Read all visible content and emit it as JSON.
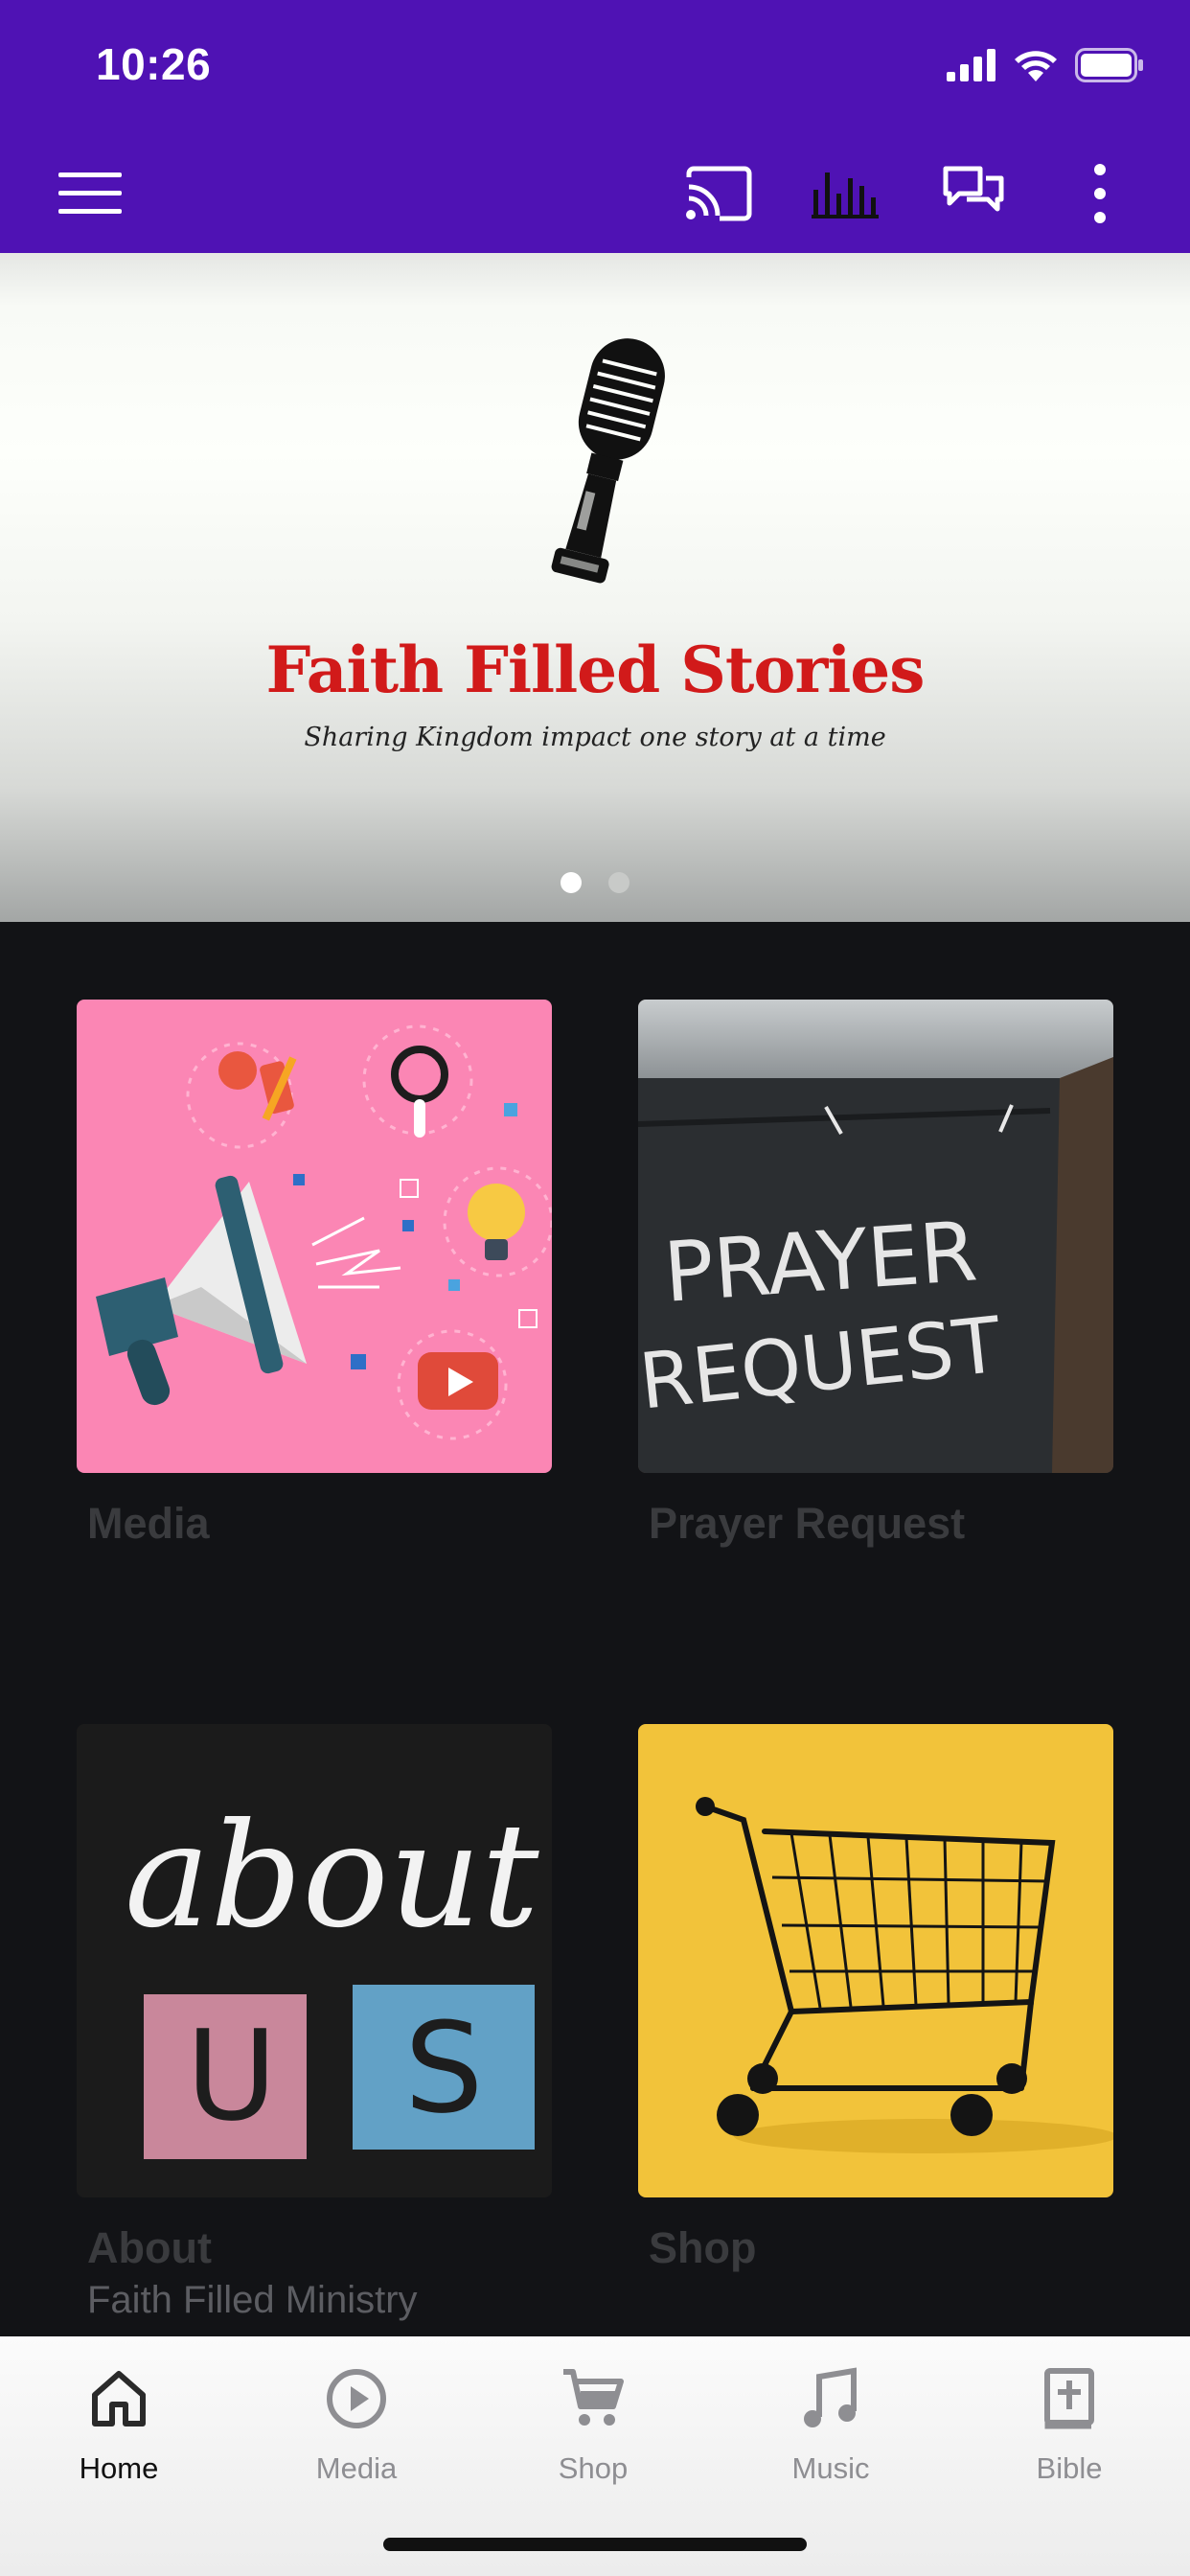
{
  "status": {
    "time": "10:26"
  },
  "hero": {
    "title": "Faith Filled Stories",
    "subtitle": "Sharing Kingdom impact one story at a time",
    "page_count": 2,
    "active_page": 1
  },
  "tiles": [
    {
      "label": "Media",
      "subtitle": "",
      "image_text": ""
    },
    {
      "label": "Prayer Request",
      "subtitle": "",
      "image_text": [
        "PRAYER",
        "REQUEST"
      ]
    },
    {
      "label": "About",
      "subtitle": "Faith Filled Ministry",
      "image_text": [
        "about",
        "U",
        "S"
      ]
    },
    {
      "label": "Shop",
      "subtitle": "",
      "image_text": ""
    }
  ],
  "tabs": [
    {
      "label": "Home",
      "icon": "home-icon",
      "active": true
    },
    {
      "label": "Media",
      "icon": "play-circle-icon",
      "active": false
    },
    {
      "label": "Shop",
      "icon": "cart-icon",
      "active": false
    },
    {
      "label": "Music",
      "icon": "music-note-icon",
      "active": false
    },
    {
      "label": "Bible",
      "icon": "bible-icon",
      "active": false
    }
  ],
  "colors": {
    "brand": "#4f12b4",
    "title_red": "#d11a1a",
    "background": "#121316"
  }
}
